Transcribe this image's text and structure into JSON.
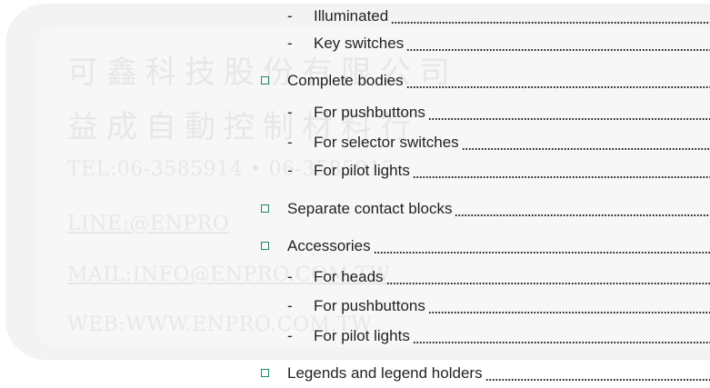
{
  "watermark": {
    "lines": [
      "可鑫科技股份有限公司",
      "益成自動控制材料行",
      "TEL:06-3585914 • 06-3585915",
      "LINE:@ENPRO",
      "MAIL:INFO@ENPRO.COM.TW",
      "WEB:WWW.ENPRO.COM.TW"
    ]
  },
  "toc": {
    "items": [
      {
        "kind": "sub",
        "dash": "-",
        "label": "Illuminated"
      },
      {
        "kind": "sub",
        "dash": "-",
        "label": "Key switches"
      },
      {
        "kind": "category",
        "label": "Complete bodies"
      },
      {
        "kind": "sub",
        "dash": "-",
        "label": "For pushbuttons"
      },
      {
        "kind": "sub",
        "dash": "-",
        "label": "For selector switches"
      },
      {
        "kind": "sub",
        "dash": "-",
        "label": "For pilot lights"
      },
      {
        "kind": "category",
        "label": "Separate contact blocks"
      },
      {
        "kind": "category",
        "label": "Accessories"
      },
      {
        "kind": "sub",
        "dash": "-",
        "label": "For heads"
      },
      {
        "kind": "sub",
        "dash": "-",
        "label": "For pushbuttons"
      },
      {
        "kind": "sub",
        "dash": "-",
        "label": "For pilot lights"
      },
      {
        "kind": "category",
        "label": "Legends and legend holders"
      }
    ]
  },
  "colors": {
    "text": "#231f20",
    "bullet": "#1f8a5a",
    "watermark": "#e7e7e7"
  },
  "icons": {
    "category_bullet": "hollow-square-icon"
  }
}
